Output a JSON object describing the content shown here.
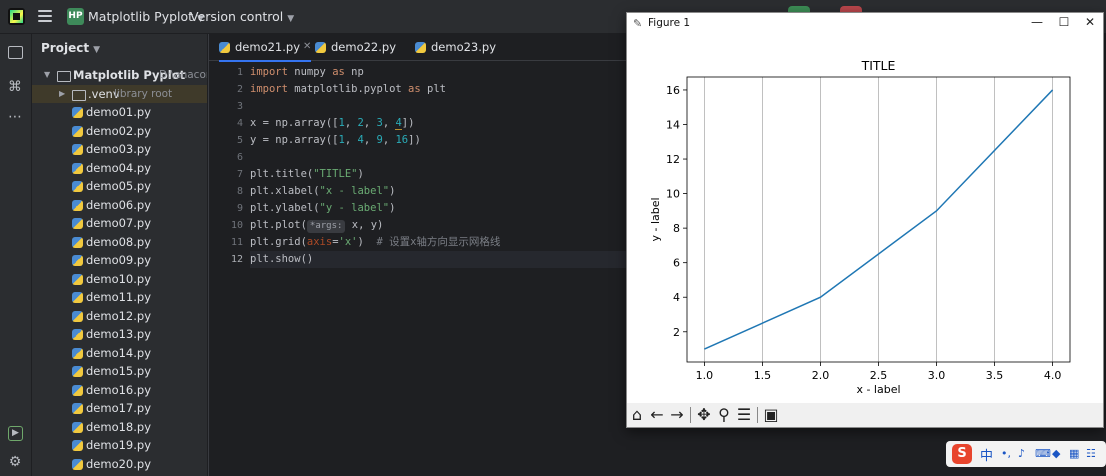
{
  "titlebar": {
    "project_badge": "HP",
    "project_name": "Matplotlib Pyplot",
    "version_control": "Version control"
  },
  "project_panel": {
    "header": "Project",
    "root_name": "Matplotlib Pyplot",
    "root_path": "D:\\anacond",
    "venv_name": ".venv",
    "venv_note": "library root",
    "files": [
      "demo01.py",
      "demo02.py",
      "demo03.py",
      "demo04.py",
      "demo05.py",
      "demo06.py",
      "demo07.py",
      "demo08.py",
      "demo09.py",
      "demo10.py",
      "demo11.py",
      "demo12.py",
      "demo13.py",
      "demo14.py",
      "demo15.py",
      "demo16.py",
      "demo17.py",
      "demo18.py",
      "demo19.py",
      "demo20.py"
    ]
  },
  "editor": {
    "tabs": [
      "demo21.py",
      "demo22.py",
      "demo23.py"
    ],
    "active_tab": 0,
    "line_numbers": [
      "1",
      "2",
      "3",
      "4",
      "5",
      "6",
      "7",
      "8",
      "9",
      "10",
      "11",
      "12"
    ],
    "current_line": 12,
    "code": {
      "l1_import": "import",
      "l1_mod": " numpy ",
      "l1_as": "as",
      "l1_alias": " np",
      "l2_import": "import",
      "l2_mod": " matplotlib.pyplot ",
      "l2_as": "as",
      "l2_alias": " plt",
      "l4_pre": "x = np.array([",
      "l4_nums": [
        "1",
        "2",
        "3",
        "4"
      ],
      "l4_post": "])",
      "l5_pre": "y = np.array([",
      "l5_nums": [
        "1",
        "4",
        "9",
        "16"
      ],
      "l5_post": "])",
      "l7_pre": "plt.title(",
      "l7_str": "\"TITLE\"",
      "l7_post": ")",
      "l8_pre": "plt.xlabel(",
      "l8_str": "\"x - label\"",
      "l8_post": ")",
      "l9_pre": "plt.ylabel(",
      "l9_str": "\"y - label\"",
      "l9_post": ")",
      "l10_pre": "plt.plot(",
      "l10_hint": "*args:",
      "l10_post": " x, y)",
      "l11_pre": "plt.grid(",
      "l11_kw": "axis",
      "l11_eq": "=",
      "l11_str": "'x'",
      "l11_post": ")  ",
      "l11_cmt": "# 设置x轴方向显示网格线",
      "l12": "plt.show()"
    }
  },
  "figure_window": {
    "title": "Figure 1",
    "toolbar_icons": [
      "home-icon",
      "back-icon",
      "forward-icon",
      "pan-icon",
      "zoom-icon",
      "configure-icon",
      "save-icon"
    ]
  },
  "chart_data": {
    "type": "line",
    "title": "TITLE",
    "xlabel": "x - label",
    "ylabel": "y - label",
    "x": [
      1,
      2,
      3,
      4
    ],
    "series": [
      {
        "values": [
          1,
          4,
          9,
          16
        ],
        "color": "#1f77b4"
      }
    ],
    "xlim": [
      0.85,
      4.15
    ],
    "ylim": [
      0.25,
      16.75
    ],
    "xticks": [
      "1.0",
      "1.5",
      "2.0",
      "2.5",
      "3.0",
      "3.5",
      "4.0"
    ],
    "xtick_values": [
      1.0,
      1.5,
      2.0,
      2.5,
      3.0,
      3.5,
      4.0
    ],
    "yticks": [
      "2",
      "4",
      "6",
      "8",
      "10",
      "12",
      "14",
      "16"
    ],
    "ytick_values": [
      2,
      4,
      6,
      8,
      10,
      12,
      14,
      16
    ],
    "grid": "x-axis only"
  },
  "tray": {
    "ime_char": "中"
  },
  "colors": {
    "accent": "#3574f0",
    "line": "#1f77b4",
    "ide_bg": "#1e1f22",
    "panel_bg": "#2b2d30"
  }
}
